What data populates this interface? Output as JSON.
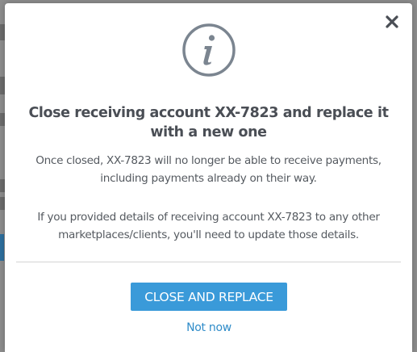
{
  "modal": {
    "title": "Close receiving account XX-7823 and replace it with a new one",
    "paragraph1": "Once closed, XX-7823 will no longer be able to receive payments, including payments already on their way.",
    "paragraph2": "If you provided details of receiving account XX-7823 to any other marketplaces/clients, you'll need to update those details.",
    "primary_button": "CLOSE AND REPLACE",
    "secondary_link": "Not now",
    "icon": "info-icon",
    "close_icon": "close-icon"
  },
  "colors": {
    "primary": "#3a9ad9",
    "link": "#2f8cc9",
    "title_text": "#4a4e55",
    "body_text": "#555a60",
    "icon_gray": "#7b8590"
  }
}
